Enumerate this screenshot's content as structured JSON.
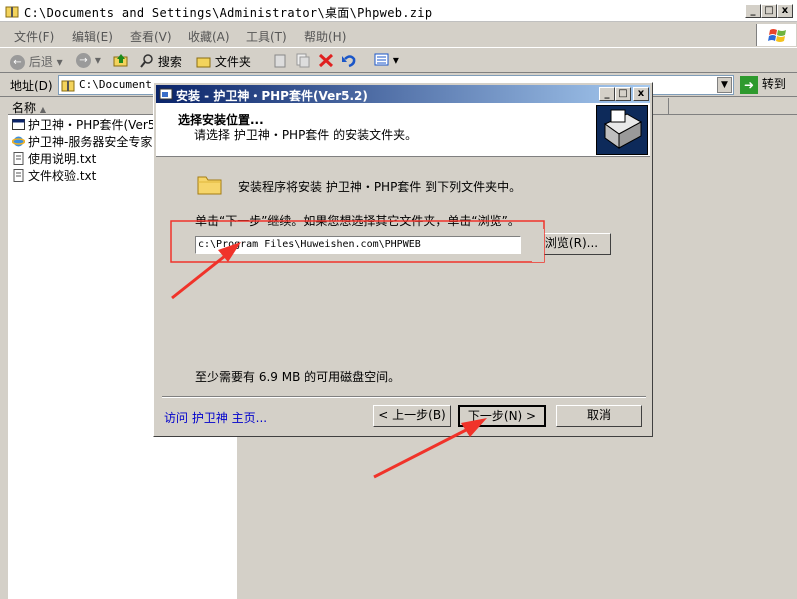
{
  "window": {
    "title": "C:\\Documents and Settings\\Administrator\\桌面\\Phpweb.zip",
    "min": "_",
    "max": "□",
    "close": "x"
  },
  "menu": [
    "文件(F)",
    "编辑(E)",
    "查看(V)",
    "收藏(A)",
    "工具(T)",
    "帮助(H)"
  ],
  "toolbar": {
    "back": "后退",
    "search": "搜索",
    "folders": "文件夹"
  },
  "address": {
    "label": "地址(D)",
    "value": "C:\\Documents",
    "go": "转到"
  },
  "list": {
    "column": "名称",
    "items": [
      {
        "name": "护卫神・PHP套件(Ver5.",
        "icon": "window-icon"
      },
      {
        "name": "护卫神-服务器安全专家",
        "icon": "ie-icon"
      },
      {
        "name": "使用说明.txt",
        "icon": "text-file-icon"
      },
      {
        "name": "文件校验.txt",
        "icon": "text-file-icon"
      }
    ]
  },
  "dialog": {
    "title": "安装 - 护卫神・PHP套件(Ver5.2)",
    "heading": "选择安装位置...",
    "subheading": "请选择 护卫神・PHP套件 的安装文件夹。",
    "info": "安装程序将安装 护卫神・PHP套件 到下列文件夹中。",
    "instruction": "单击“下一步”继续。如果您想选择其它文件夹，单击“浏览”。",
    "path": "c:\\Program Files\\Huweishen.com\\PHPWEB",
    "browse": "浏览(R)...",
    "space": "至少需要有 6.9 MB 的可用磁盘空间。",
    "link": "访问 护卫神 主页...",
    "back": "< 上一步(B)",
    "next": "下一步(N) >",
    "cancel": "取消"
  },
  "colors": {
    "annotation": "#f0332a",
    "titlebar_dark": "#0a246a",
    "titlebar_light": "#a6caf0",
    "link": "#0000cc"
  }
}
